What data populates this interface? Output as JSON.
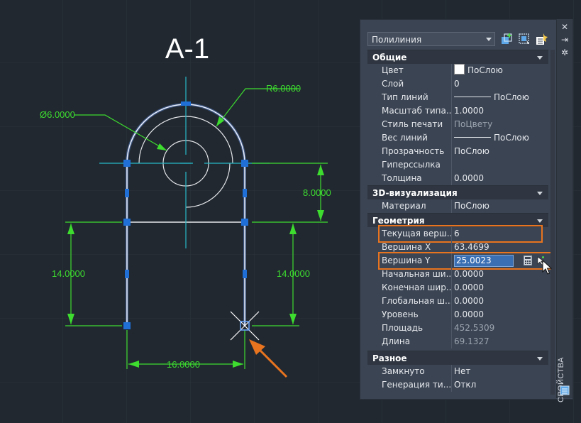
{
  "drawing": {
    "title": "А-1",
    "dimensions": {
      "radius": "R6.0000",
      "diameter": "Ø6.0000",
      "vertical_right_top": "8.0000",
      "vertical_left": "14.0000",
      "vertical_right": "14.0000",
      "horizontal_bottom": "16.0000"
    },
    "colors": {
      "background": "#212830",
      "dimension": "#3ddc2f",
      "grip": "#1f6fd6",
      "centerline": "#27b7c7",
      "highlight_arrow": "#e8741f"
    }
  },
  "palette": {
    "object_type": "Полилиния",
    "side_label": "СВОЙСТВА",
    "toolbar_icons": [
      "toggle-pickadd-icon",
      "select-objects-icon",
      "quick-select-icon"
    ],
    "strip_icons": [
      "close-icon",
      "auto-hide-icon",
      "properties-settings-icon"
    ],
    "sections": {
      "general": {
        "title": "Общие",
        "rows": [
          {
            "label": "Цвет",
            "value": "ПоСлою"
          },
          {
            "label": "Слой",
            "value": "0"
          },
          {
            "label": "Тип линий",
            "value": "ПоСлою"
          },
          {
            "label": "Масштаб типа...",
            "value": "1.0000"
          },
          {
            "label": "Стиль печати",
            "value": "ПоЦвету"
          },
          {
            "label": "Вес линий",
            "value": "ПоСлою"
          },
          {
            "label": "Прозрачность",
            "value": "ПоСлою"
          },
          {
            "label": "Гиперссылка",
            "value": ""
          },
          {
            "label": "Толщина",
            "value": "0.0000"
          }
        ]
      },
      "visual3d": {
        "title": "3D-визуализация",
        "rows": [
          {
            "label": "Материал",
            "value": "ПоСлою"
          }
        ]
      },
      "geometry": {
        "title": "Геометрия",
        "rows": [
          {
            "label": "Текущая верш...",
            "value": "6"
          },
          {
            "label": "Вершина X",
            "value": "63.4699"
          },
          {
            "label": "Вершина Y",
            "value": "25.0023"
          },
          {
            "label": "Начальная ши...",
            "value": "0.0000"
          },
          {
            "label": "Конечная шир...",
            "value": "0.0000"
          },
          {
            "label": "Глобальная ш...",
            "value": "0.0000"
          },
          {
            "label": "Уровень",
            "value": "0.0000"
          },
          {
            "label": "Площадь",
            "value": "452.5309"
          },
          {
            "label": "Длина",
            "value": "69.1327"
          }
        ]
      },
      "misc": {
        "title": "Разное",
        "rows": [
          {
            "label": "Замкнуто",
            "value": "Нет"
          },
          {
            "label": "Генерация  ти...",
            "value": "Откл"
          }
        ]
      }
    }
  }
}
